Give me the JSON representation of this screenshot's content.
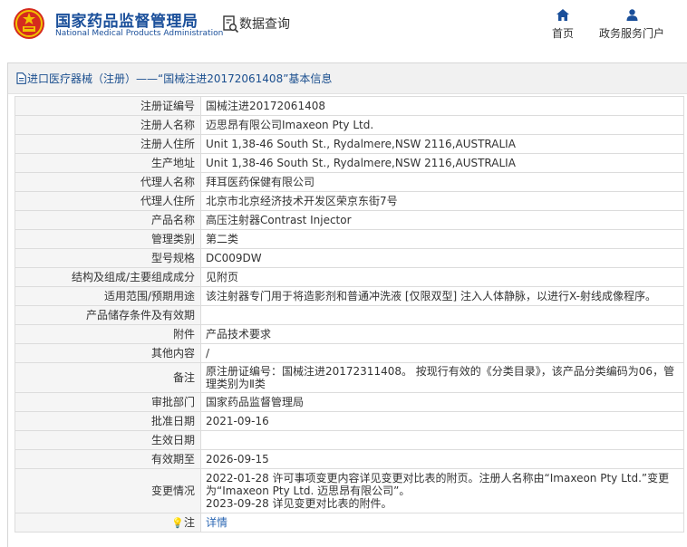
{
  "header": {
    "site_name_cn": "国家药品监督管理局",
    "site_name_en": "National Medical Products Administration",
    "search_label": "数据查询",
    "nav": [
      {
        "label": "首页",
        "icon": "home-icon"
      },
      {
        "label": "政务服务门户",
        "icon": "user-icon"
      }
    ]
  },
  "panel": {
    "title": "进口医疗器械（注册）——“国械注进20172061408”基本信息",
    "title_icon": "document-icon"
  },
  "table": {
    "rows": [
      {
        "key": "注册证编号",
        "value": "国械注进20172061408"
      },
      {
        "key": "注册人名称",
        "value": "迈思昂有限公司Imaxeon Pty Ltd."
      },
      {
        "key": "注册人住所",
        "value": "Unit 1,38-46 South St., Rydalmere,NSW 2116,AUSTRALIA"
      },
      {
        "key": "生产地址",
        "value": "Unit 1,38-46 South St., Rydalmere,NSW 2116,AUSTRALIA"
      },
      {
        "key": "代理人名称",
        "value": "拜耳医药保健有限公司"
      },
      {
        "key": "代理人住所",
        "value": "北京市北京经济技术开发区荣京东街7号"
      },
      {
        "key": "产品名称",
        "value": "高压注射器Contrast Injector"
      },
      {
        "key": "管理类别",
        "value": "第二类"
      },
      {
        "key": "型号规格",
        "value": "DC009DW"
      },
      {
        "key": "结构及组成/主要组成成分",
        "value": "见附页"
      },
      {
        "key": "适用范围/预期用途",
        "value": "该注射器专门用于将造影剂和普通冲洗液 [仅限双型] 注入人体静脉，以进行X-射线成像程序。"
      },
      {
        "key": "产品储存条件及有效期",
        "value": ""
      },
      {
        "key": "附件",
        "value": "产品技术要求"
      },
      {
        "key": "其他内容",
        "value": "/"
      },
      {
        "key": "备注",
        "value": "原注册证编号：国械注进20172311408。 按现行有效的《分类目录》，该产品分类编码为06，管理类别为Ⅱ类"
      },
      {
        "key": "审批部门",
        "value": "国家药品监督管理局"
      },
      {
        "key": "批准日期",
        "value": "2021-09-16"
      },
      {
        "key": "生效日期",
        "value": ""
      },
      {
        "key": "有效期至",
        "value": "2026-09-15"
      },
      {
        "key": "变更情况",
        "lines": [
          "2022-01-28 许可事项变更内容详见变更对比表的附页。注册人名称由“Imaxeon Pty Ltd.”变更为“Imaxeon Pty Ltd. 迈思昂有限公司”。",
          "2023-09-28 详见变更对比表的附件。"
        ]
      },
      {
        "key": "注",
        "value": "详情",
        "icon": "lightbulb-icon"
      }
    ]
  },
  "colors": {
    "brand_blue": "#1a4f9a",
    "link_blue": "#2b67b3",
    "emblem_red": "#d52b1e",
    "emblem_gold": "#f2c200"
  }
}
